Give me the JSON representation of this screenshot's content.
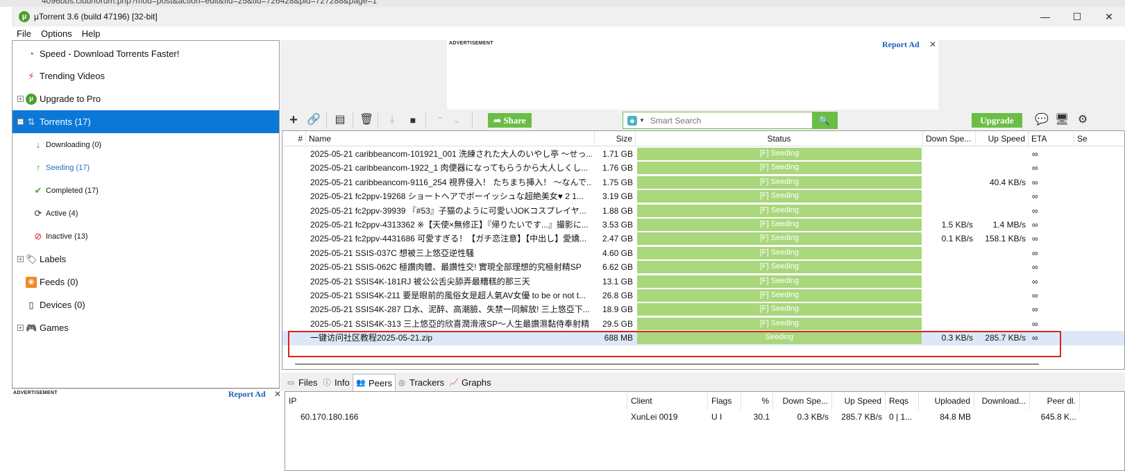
{
  "browser": {
    "url_fragment": "4096bbs.club/forum.php?mod=post&action=edit&fid=25&tid=726428&pid=727288&page=1"
  },
  "window": {
    "title": "µTorrent 3.6  (build 47196) [32-bit]",
    "minimize": "—",
    "maximize": "☐",
    "close": "✕"
  },
  "menu": {
    "file": "File",
    "options": "Options",
    "help": "Help"
  },
  "sidebar": {
    "speed": "Speed - Download Torrents Faster!",
    "trending": "Trending Videos",
    "upgrade": "Upgrade to Pro",
    "torrents": "Torrents (17)",
    "downloading": "Downloading (0)",
    "seeding": "Seeding (17)",
    "completed": "Completed (17)",
    "active": "Active (4)",
    "inactive": "Inactive (13)",
    "labels": "Labels",
    "feeds": "Feeds (0)",
    "devices": "Devices (0)",
    "games": "Games"
  },
  "ads": {
    "label": "ADVERTISEMENT",
    "report": "Report Ad",
    "close": "✕"
  },
  "toolbar": {
    "share": "Share",
    "search_placeholder": "Smart Search",
    "upgrade": "Upgrade"
  },
  "list": {
    "columns": {
      "num": "#",
      "name": "Name",
      "size": "Size",
      "status": "Status",
      "down": "Down Spe...",
      "up": "Up Speed",
      "eta": "ETA",
      "seeds": "Se"
    },
    "rows": [
      {
        "name": "2025-05-21 caribbeancom-101921_001 洗練された大人のいやし亭 ～せっ...",
        "size": "1.71 GB",
        "status": "[F] Seeding",
        "down": "",
        "up": "",
        "eta": "∞"
      },
      {
        "name": "2025-05-21 caribbeancom-1922_1 肉便器になってもらうから大人しくし...",
        "size": "1.76 GB",
        "status": "[F] Seeding",
        "down": "",
        "up": "",
        "eta": "∞"
      },
      {
        "name": "2025-05-21 caribbeancom-9116_254 視界侵入！ たちまち挿入！ ～なんで...",
        "size": "1.75 GB",
        "status": "[F] Seeding",
        "down": "",
        "up": "40.4 KB/s",
        "eta": "∞"
      },
      {
        "name": "2025-05-21 fc2ppv-19268 ショートヘアでボーイッシュな超絶美女♥ 2 1...",
        "size": "3.19 GB",
        "status": "[F] Seeding",
        "down": "",
        "up": "",
        "eta": "∞"
      },
      {
        "name": "2025-05-21 fc2ppv-39939 『#53』子猫のように可愛いJOKコスプレイヤ...",
        "size": "1.88 GB",
        "status": "[F] Seeding",
        "down": "",
        "up": "",
        "eta": "∞"
      },
      {
        "name": "2025-05-21 fc2ppv-4313362 ※【天使×無修正】『帰りたいです...』撮影に...",
        "size": "3.53 GB",
        "status": "[F] Seeding",
        "down": "1.5 KB/s",
        "up": "1.4 MB/s",
        "eta": "∞"
      },
      {
        "name": "2025-05-21 fc2ppv-4431686 可愛すぎる！【ガチ恋注意】【中出し】愛嬌...",
        "size": "2.47 GB",
        "status": "[F] Seeding",
        "down": "0.1 KB/s",
        "up": "158.1 KB/s",
        "eta": "∞"
      },
      {
        "name": "2025-05-21 SSIS-037C 想被三上悠亞逆性騷",
        "size": "4.60 GB",
        "status": "[F] Seeding",
        "down": "",
        "up": "",
        "eta": "∞"
      },
      {
        "name": "2025-05-21 SSIS-062C 極讚肉體、最讚性交! 實現全部理想的究極射精SP",
        "size": "6.62 GB",
        "status": "[F] Seeding",
        "down": "",
        "up": "",
        "eta": "∞"
      },
      {
        "name": "2025-05-21 SSIS4K-181RJ 被公公舌尖舔弄最糟糕的那三天",
        "size": "13.1 GB",
        "status": "[F] Seeding",
        "down": "",
        "up": "",
        "eta": "∞"
      },
      {
        "name": "2025-05-21 SSIS4K-211 要是眼前的風俗女是超人氣AV女優 to be or not t...",
        "size": "26.8 GB",
        "status": "[F] Seeding",
        "down": "",
        "up": "",
        "eta": "∞"
      },
      {
        "name": "2025-05-21 SSIS4K-287 口水、泥醉、高潮臉、失禁一同解放! 三上悠亞下...",
        "size": "18.9 GB",
        "status": "[F] Seeding",
        "down": "",
        "up": "",
        "eta": "∞"
      },
      {
        "name": "2025-05-21 SSIS4K-313 三上悠亞的欣喜潤滑液SP～人生最讚濕黏侍奉射精",
        "size": "29.5 GB",
        "status": "[F] Seeding",
        "down": "",
        "up": "",
        "eta": "∞"
      },
      {
        "name": "一键访问社区教程2025-05-21.zip",
        "size": "688 MB",
        "status": "Seeding",
        "down": "0.3 KB/s",
        "up": "285.7 KB/s",
        "eta": "∞"
      }
    ]
  },
  "tabs": {
    "files": "Files",
    "info": "Info",
    "peers": "Peers",
    "trackers": "Trackers",
    "graphs": "Graphs"
  },
  "peers": {
    "columns": {
      "ip": "IP",
      "client": "Client",
      "flags": "Flags",
      "pct": "%",
      "down": "Down Spe...",
      "up": "Up Speed",
      "reqs": "Reqs",
      "uploaded": "Uploaded",
      "downloaded": "Download...",
      "peerdl": "Peer dl."
    },
    "row": {
      "ip": "60.170.180.166",
      "client": "XunLei 0019",
      "flags": "U I",
      "pct": "30.1",
      "down": "0.3 KB/s",
      "up": "285.7 KB/s",
      "reqs": "0 | 1...",
      "uploaded": "84.8 MB",
      "downloaded": "",
      "peerdl": "645.8 K..."
    }
  },
  "colors": {
    "accent": "#0b78d7",
    "green": "#6bbe45",
    "seeding": "#a9d77c",
    "highlight_border": "#e0201c"
  }
}
